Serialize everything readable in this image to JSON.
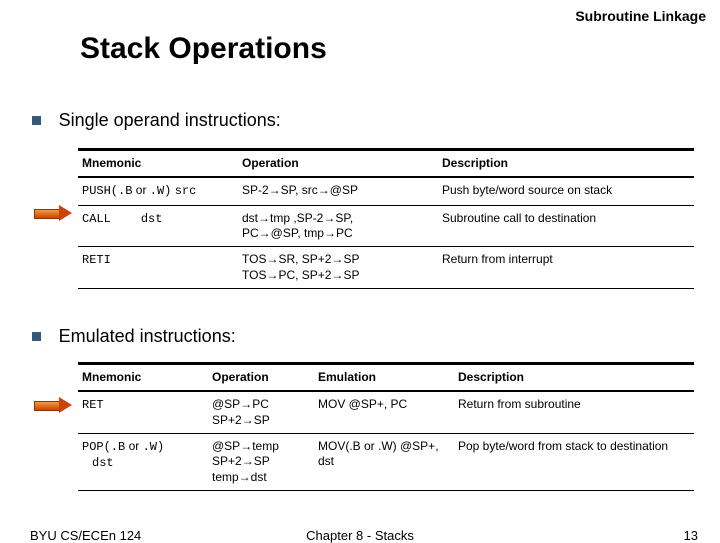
{
  "corner_title": "Subroutine Linkage",
  "main_title": "Stack Operations",
  "section1_label": "Single operand instructions:",
  "section2_label": "Emulated instructions:",
  "table1": {
    "headers": {
      "c0": "Mnemonic",
      "c1": "Operation",
      "c2": "Description"
    },
    "rows": [
      {
        "mn_a": "PUSH(.B",
        "mn_b": "or",
        "mn_c": ".W)",
        "mn_d": "src",
        "op": "SP-2→SP, src→@SP",
        "desc": "Push byte/word source on stack"
      },
      {
        "mn_a": "CALL",
        "mn_b": "",
        "mn_c": "",
        "mn_d": "dst",
        "op": "dst→tmp ,SP-2→SP,\nPC→@SP, tmp→PC",
        "desc": "Subroutine call to destination"
      },
      {
        "mn_a": "RETI",
        "mn_b": "",
        "mn_c": "",
        "mn_d": "",
        "op": "TOS→SR, SP+2→SP\nTOS→PC, SP+2→SP",
        "desc": "Return from interrupt"
      }
    ]
  },
  "table2": {
    "headers": {
      "c0": "Mnemonic",
      "c1": "Operation",
      "c2": "Emulation",
      "c3": "Description"
    },
    "rows": [
      {
        "mn_a": "RET",
        "mn_b": "",
        "mn_c": "",
        "mn_d": "",
        "op": "@SP→PC\nSP+2→SP",
        "emu": "MOV @SP+, PC",
        "desc": "Return from subroutine"
      },
      {
        "mn_a": "POP(.B",
        "mn_b": "or",
        "mn_c": ".W)",
        "mn_d": "dst",
        "op": "@SP→temp\nSP+2→SP\ntemp→dst",
        "emu": "MOV(.B or .W)  @SP+, dst",
        "desc": "Pop byte/word from stack to destination"
      }
    ]
  },
  "footer": {
    "left": "BYU CS/ECEn 124",
    "center": "Chapter 8 - Stacks",
    "right": "13"
  }
}
